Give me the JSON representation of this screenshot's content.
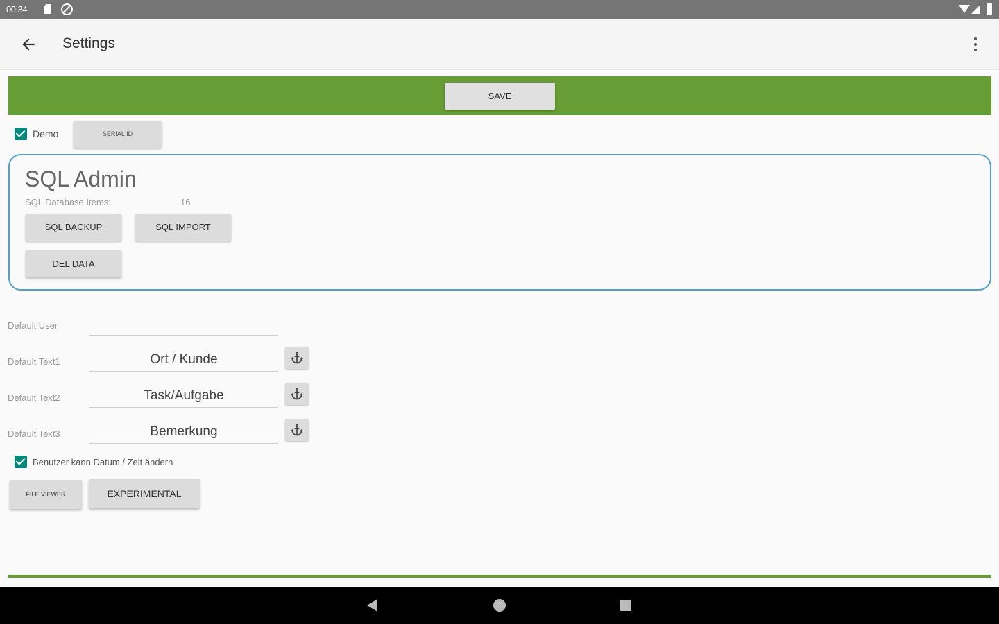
{
  "status_bar": {
    "time": "00:34"
  },
  "app_bar": {
    "title": "Settings"
  },
  "save": {
    "label": "SAVE"
  },
  "demo": {
    "label": "Demo",
    "checked": true,
    "serial_button": "SERIAL ID"
  },
  "sql_admin": {
    "title": "SQL Admin",
    "items_label": "SQL Database Items:",
    "items_count": "16",
    "backup_button": "SQL BACKUP",
    "import_button": "SQL IMPORT",
    "del_button": "DEL DATA"
  },
  "fields": {
    "default_user": {
      "label": "Default User",
      "value": ""
    },
    "text1": {
      "label": "Default Text1",
      "value": "Ort / Kunde"
    },
    "text2": {
      "label": "Default Text2",
      "value": "Task/Aufgabe"
    },
    "text3": {
      "label": "Default Text3",
      "value": "Bemerkung"
    }
  },
  "datetime_option": {
    "label": "Benutzer kann Datum / Zeit ändern",
    "checked": true
  },
  "buttons": {
    "file_viewer": "FILE VIEWER",
    "experimental": "EXPERIMENTAL"
  },
  "colors": {
    "accent_green": "#669d34",
    "panel_border": "#4f9fd0",
    "checkbox": "#00897b"
  },
  "icons": [
    "arrow-back-icon",
    "more-vert-icon",
    "anchor-icon",
    "sd-card-icon",
    "do-not-disturb-icon",
    "wifi-icon",
    "signal-icon",
    "battery-icon"
  ]
}
